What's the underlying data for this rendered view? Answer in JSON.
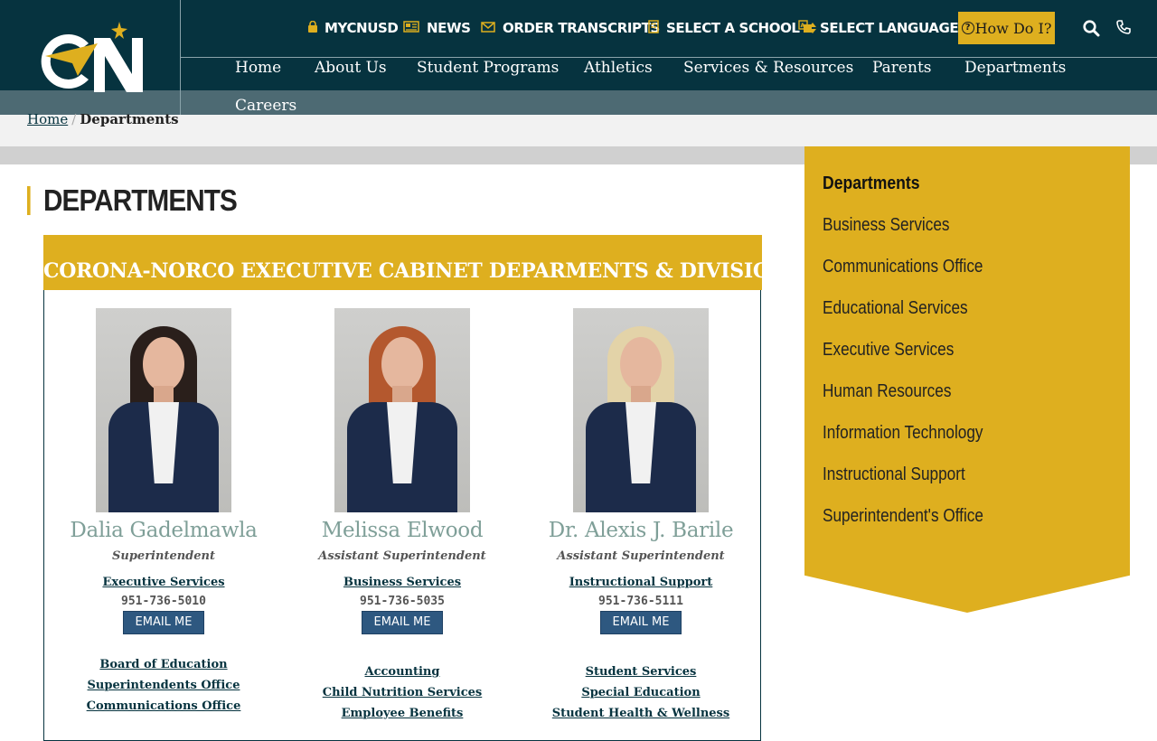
{
  "header": {
    "utility": [
      {
        "label": "MYCNUSD",
        "icon": "lock-icon"
      },
      {
        "label": "NEWS",
        "icon": "newspaper-icon"
      },
      {
        "label": "ORDER TRANSCRIPTS",
        "icon": "envelope-icon"
      },
      {
        "label": "SELECT A SCHOOL",
        "icon": "building-icon"
      },
      {
        "label": "SELECT LANGUAGE",
        "icon": "translate-icon"
      }
    ],
    "how_do_i": "How Do I?",
    "colors": {
      "primary": "#06333f",
      "accent": "#deaf1f",
      "band": "#4d6a73"
    }
  },
  "nav": [
    "Home",
    "About Us",
    "Student Programs",
    "Athletics",
    "Services & Resources",
    "Parents",
    "Departments",
    "Careers"
  ],
  "breadcrumb": {
    "home": "Home",
    "separator": "/",
    "current": "Departments"
  },
  "page": {
    "title": "DEPARTMENTS"
  },
  "cabinet": {
    "heading": "CORONA-NORCO EXECUTIVE CABINET DEPARMENTS & DIVISIONS",
    "email_label": "EMAIL ME",
    "people": [
      {
        "name": "Dalia Gadelmawla",
        "title": "Superintendent",
        "department": "Executive Services",
        "phone": "951-736-5010",
        "links": [
          "Board of Education",
          "Superintendents Office",
          "Communications Office"
        ]
      },
      {
        "name": "Melissa Elwood",
        "title": "Assistant Superintendent",
        "department": "Business Services",
        "phone": "951-736-5035",
        "links": [
          "Accounting",
          "Child Nutrition Services",
          "Employee Benefits"
        ]
      },
      {
        "name": "Dr. Alexis J. Barile",
        "title": "Assistant Superintendent",
        "department": "Instructional Support",
        "phone": "951-736-5111",
        "links": [
          "Student Services",
          "Special Education",
          "Student Health & Wellness"
        ]
      }
    ]
  },
  "sidenav": {
    "title": "Departments",
    "items": [
      "Business Services",
      "Communications Office",
      "Educational Services",
      "Executive Services",
      "Human Resources",
      "Information Technology",
      "Instructional Support",
      "Superintendent's Office"
    ]
  }
}
